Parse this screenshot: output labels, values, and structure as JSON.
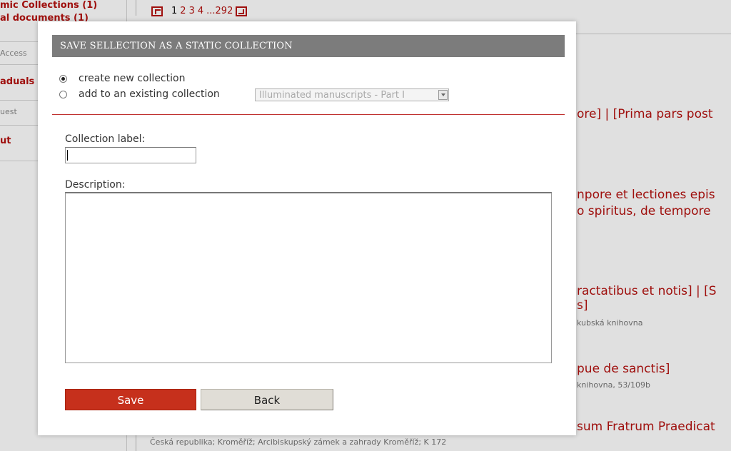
{
  "sidebar": {
    "items": [
      {
        "label": "mic Collections (1)",
        "kind": "link"
      },
      {
        "label": "al documents (1)",
        "kind": "link"
      },
      {
        "label": "Access",
        "kind": "box"
      },
      {
        "label": "aduals",
        "kind": "link"
      },
      {
        "label": "uest",
        "kind": "box"
      },
      {
        "label": "ut",
        "kind": "link"
      }
    ]
  },
  "pager": {
    "current": "1",
    "pages": [
      "2",
      "3",
      "4"
    ],
    "ellipsis": "...292"
  },
  "background_results": [
    {
      "text": "ore] | [Prima pars post",
      "kind": "title"
    },
    {
      "text": "npore et lectiones epis",
      "kind": "title"
    },
    {
      "text": "o spiritus, de tempore",
      "kind": "title"
    },
    {
      "text": "ractatibus et notis] | [S",
      "kind": "title"
    },
    {
      "text": "s]",
      "kind": "title"
    },
    {
      "text": "kubská knihovna",
      "kind": "small"
    },
    {
      "text": "pue de sanctis]",
      "kind": "title"
    },
    {
      "text": "knihovna, 53/109b",
      "kind": "small"
    },
    {
      "text": "sum Fratrum Praedicat",
      "kind": "title"
    }
  ],
  "footer_text": "Česká republika; Kroměříž; Arcibiskupský zámek a zahrady Kroměříž; K 172",
  "dialog": {
    "title": "SAVE SELLECTION AS A STATIC COLLECTION",
    "option_new": "create new collection",
    "option_existing": "add to an existing collection",
    "selected_option": "create new collection",
    "existing_select_value": "Illuminated manuscripts - Part I",
    "label_field": "Collection label:",
    "label_value": "",
    "description_field": "Description:",
    "description_value": "",
    "save_label": "Save",
    "back_label": "Back"
  },
  "colors": {
    "accent_red": "#b5120f",
    "save_button": "#c6301c",
    "title_bar": "#7c7c7c"
  }
}
